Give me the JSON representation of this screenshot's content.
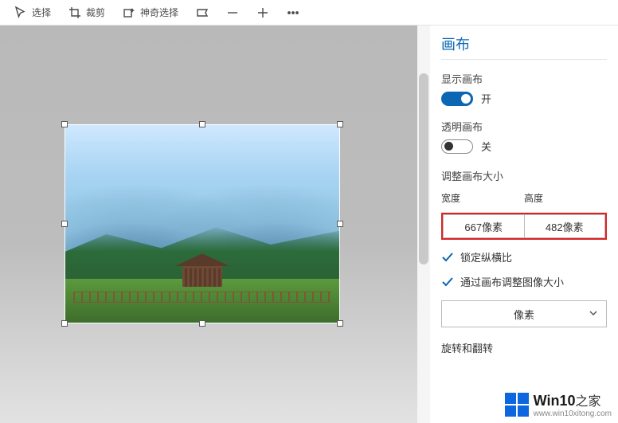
{
  "toolbar": {
    "select_label": "选择",
    "crop_label": "裁剪",
    "magic_select_label": "神奇选择"
  },
  "panel": {
    "title": "画布",
    "show_canvas_label": "显示画布",
    "show_canvas_state": "开",
    "transparent_canvas_label": "透明画布",
    "transparent_canvas_state": "关",
    "resize_label": "调整画布大小",
    "width_label": "宽度",
    "height_label": "高度",
    "width_value": "667像素",
    "height_value": "482像素",
    "lock_aspect_label": "锁定纵横比",
    "resize_image_with_canvas_label": "通过画布调整图像大小",
    "unit_label": "像素",
    "rotate_flip_label": "旋转和翻转"
  },
  "watermark": {
    "brand_primary": "Win10",
    "brand_secondary": "之家",
    "url": "www.win10xitong.com"
  }
}
